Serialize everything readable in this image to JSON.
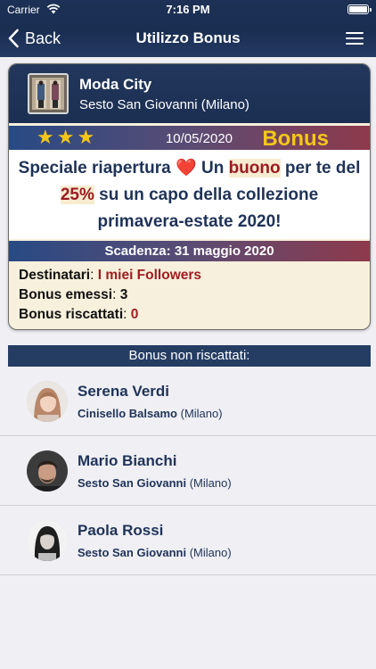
{
  "status_bar": {
    "carrier": "Carrier",
    "time": "7:16 PM"
  },
  "nav": {
    "back_label": "Back",
    "title": "Utilizzo Bonus"
  },
  "bonus": {
    "shop_name": "Moda City",
    "shop_location": "Sesto San Giovanni (Milano)",
    "stars": "★★★",
    "rating": 3,
    "date": "10/05/2020",
    "bonus_label": "Bonus",
    "offer": {
      "t1": "Speciale riapertura ",
      "heart": "❤️",
      "t2": " Un ",
      "hl1": "buono",
      "t3": " per te del ",
      "hl2": "25%",
      "t4": " su un capo della collezione primavera-estate 2020!"
    },
    "deadline": "Scadenza: 31 maggio 2020",
    "recipients_label": "Destinatari",
    "recipients_value": "I miei Followers",
    "issued_label": "Bonus emessi",
    "issued_value": "3",
    "redeemed_label": "Bonus riscattati",
    "redeemed_value": "0",
    "sep": ": "
  },
  "section_title": "Bonus non riscattati:",
  "people": [
    {
      "name": "Serena Verdi",
      "city": "Cinisello Balsamo",
      "province": "(Milano)"
    },
    {
      "name": "Mario Bianchi",
      "city": "Sesto San Giovanni",
      "province": "(Milano)"
    },
    {
      "name": "Paola Rossi",
      "city": "Sesto San Giovanni",
      "province": "(Milano)"
    }
  ],
  "colors": {
    "navy": "#1b2f52",
    "highlight_red": "#9b1a20",
    "star_gold": "#f5c518",
    "bonus_gold": "#f4c71b"
  }
}
